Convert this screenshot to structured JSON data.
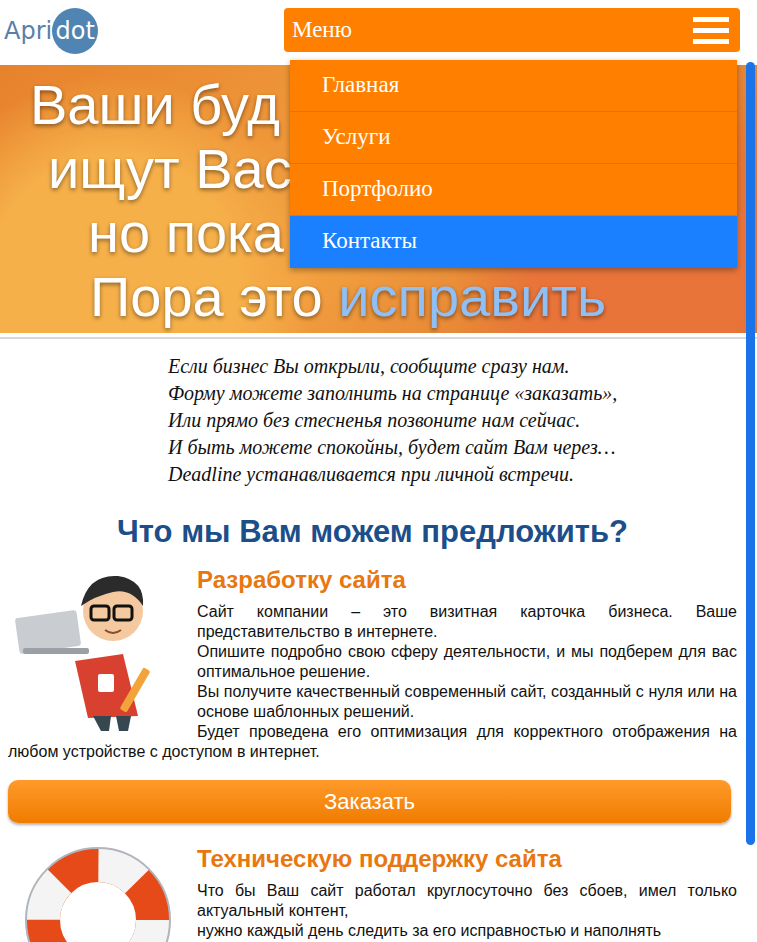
{
  "logo": {
    "text": "Apri",
    "badge": "dot"
  },
  "menu": {
    "label": "Меню",
    "open": true,
    "items": [
      {
        "label": "Главная",
        "selected": false
      },
      {
        "label": "Услуги",
        "selected": false
      },
      {
        "label": "Портфолио",
        "selected": false
      },
      {
        "label": "Контакты",
        "selected": true
      }
    ]
  },
  "hero": {
    "lines": [
      [
        {
          "text": "Ваши буд",
          "highlight": false
        }
      ],
      [
        {
          "text": "ищут Вас",
          "highlight": false
        }
      ],
      [
        {
          "text": "но пока",
          "highlight": false
        }
      ],
      [
        {
          "text": "Пора это ",
          "highlight": false
        },
        {
          "text": "исправить",
          "highlight": true
        }
      ]
    ]
  },
  "poem": [
    "Если бизнес Вы открыли, сообщите сразу нам.",
    "Форму можете заполнить на странице «заказать»,",
    "Или прямо без стесненья позвоните нам сейчас.",
    "И быть можете спокойны, будет сайт Вам через…",
    "Deadline устанавливается при личной встречи."
  ],
  "heading": "Что мы Вам можем предложить?",
  "services": [
    {
      "kind": "developer",
      "title": "Разработку сайта",
      "paragraphs": [
        "Сайт компании – это визитная карточка бизнеса. Ваше представительство в интернете.",
        "Опишите подробно свою сферу деятельности, и мы подберем для вас оптимальное решение.",
        "Вы получите качественный современный сайт, созданный с нуля или на основе шаблонных решений.",
        "Будет проведена его оптимизация для корректного отображения на любом устройстве с доступом в интернет."
      ],
      "button": "Заказать"
    },
    {
      "kind": "support",
      "title": "Техническую поддержку сайта",
      "paragraphs": [
        "Что бы Ваш сайт работал круглосуточно без сбоев, имел только актуальный контент,",
        "нужно каждый день следить за его исправностью и наполнять"
      ]
    }
  ]
}
